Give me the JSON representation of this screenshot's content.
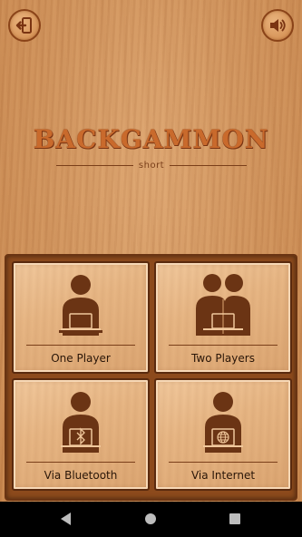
{
  "header": {
    "back_icon": "exit-arrow-icon",
    "sound_icon": "speaker-icon"
  },
  "logo": {
    "title": "BACKGAMMON",
    "subtitle": "short"
  },
  "modes": [
    {
      "label": "One Player",
      "icon": "single-player-icon"
    },
    {
      "label": "Two Players",
      "icon": "two-players-icon"
    },
    {
      "label": "Via Bluetooth",
      "icon": "bluetooth-player-icon"
    },
    {
      "label": "Via Internet",
      "icon": "internet-player-icon"
    }
  ],
  "colors": {
    "wood": "#d39760",
    "accent": "#c96a2c",
    "dark_brown": "#6a3412"
  }
}
